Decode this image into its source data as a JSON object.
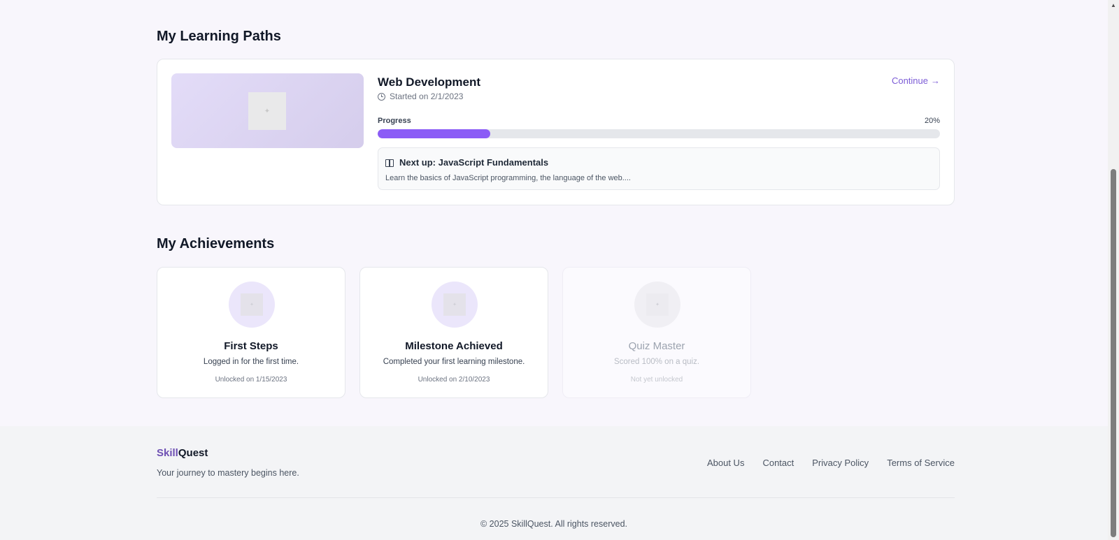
{
  "learning_paths": {
    "section_title": "My Learning Paths",
    "items": [
      {
        "title": "Web Development",
        "started": "Started on 2/1/2023",
        "continue_label": "Continue",
        "progress_label": "Progress",
        "progress_text": "20%",
        "progress_fraction": 0.2,
        "next_up_title": "Next up: JavaScript Fundamentals",
        "next_up_description": "Learn the basics of JavaScript programming, the language of the web...."
      }
    ]
  },
  "achievements": {
    "section_title": "My Achievements",
    "items": [
      {
        "title": "First Steps",
        "description": "Logged in for the first time.",
        "status": "Unlocked on 1/15/2023",
        "unlocked": true
      },
      {
        "title": "Milestone Achieved",
        "description": "Completed your first learning milestone.",
        "status": "Unlocked on 2/10/2023",
        "unlocked": true
      },
      {
        "title": "Quiz Master",
        "description": "Scored 100% on a quiz.",
        "status": "Not yet unlocked",
        "unlocked": false
      }
    ]
  },
  "footer": {
    "brand_part1": "Skill",
    "brand_part2": "Quest",
    "tagline": "Your journey to mastery begins here.",
    "links": [
      "About Us",
      "Contact",
      "Privacy Policy",
      "Terms of Service"
    ],
    "copyright": "© 2025 SkillQuest. All rights reserved."
  },
  "colors": {
    "accent": "#8b5cf6",
    "link_accent": "#7c5cd6",
    "brand_accent": "#6d4fb3"
  }
}
